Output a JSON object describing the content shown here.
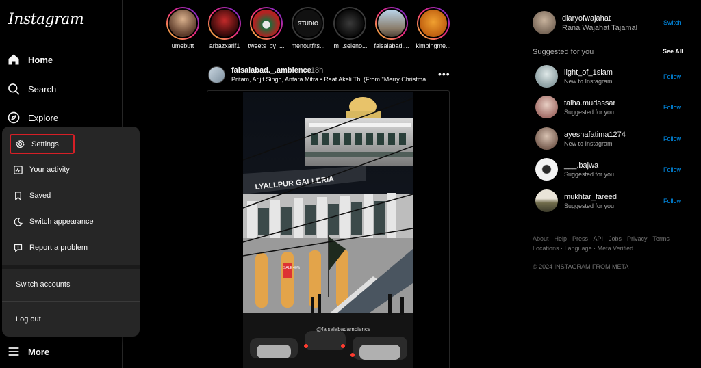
{
  "app": {
    "logo": "Instagram"
  },
  "sidebar": {
    "home": "Home",
    "search": "Search",
    "explore": "Explore",
    "more": "More"
  },
  "menu": {
    "items": [
      "Settings",
      "Your activity",
      "Saved",
      "Switch appearance",
      "Report a problem"
    ],
    "switch_accounts": "Switch accounts",
    "logout": "Log out"
  },
  "stories": [
    {
      "name": "umebutt",
      "seen": false
    },
    {
      "name": "arbazxarif1",
      "seen": false
    },
    {
      "name": "tweets_by_...",
      "seen": false
    },
    {
      "name": "menoutfits...",
      "seen": true,
      "label": "STUDIO"
    },
    {
      "name": "im_.seleno...",
      "seen": true
    },
    {
      "name": "faisalabad....",
      "seen": false
    },
    {
      "name": "kimbingme...",
      "seen": false
    }
  ],
  "post": {
    "user": "faisalabad._.ambience",
    "time": "• 18h",
    "audio": "Pritam, Arijit Singh, Antara Mitra • Raat Akeli Thi (From \"Merry Christma...",
    "more": "•••",
    "sign_text": "LYALLPUR GALLERIA",
    "sale_text": "SALE 40%",
    "watermark": "@faisalabadambience"
  },
  "account": {
    "username": "diaryofwajahat",
    "fullname": "Rana Wajahat Tajamal",
    "switch_label": "Switch"
  },
  "suggestions": {
    "title": "Suggested for you",
    "see_all": "See All",
    "follow_label": "Follow",
    "users": [
      {
        "username": "light_of_1slam",
        "sub": "New to Instagram"
      },
      {
        "username": "talha.mudassar",
        "sub": "Suggested for you"
      },
      {
        "username": "ayeshafatima1274",
        "sub": "New to Instagram"
      },
      {
        "username": "___.bajwa",
        "sub": "Suggested for you"
      },
      {
        "username": "mukhtar_fareed",
        "sub": "Suggested for you"
      }
    ]
  },
  "footer": {
    "links": "About · Help · Press · API · Jobs · Privacy · Terms · Locations · Language · Meta Verified",
    "copyright": "© 2024 INSTAGRAM FROM META"
  },
  "colors": {
    "accent_blue": "#0095f6",
    "highlight_red": "#d61f26",
    "menu_bg": "#262626"
  }
}
